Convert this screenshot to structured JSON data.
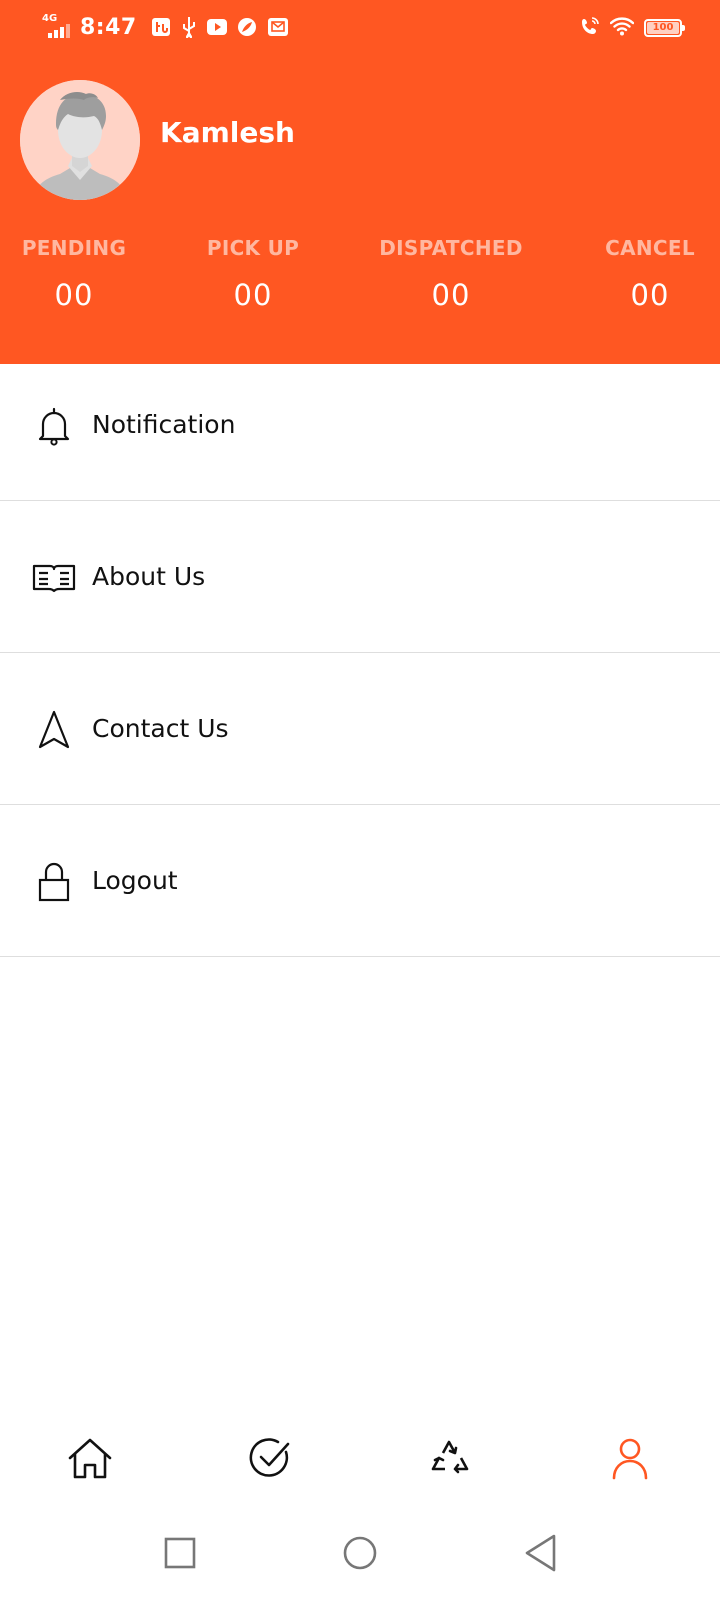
{
  "status_bar": {
    "network": "4G",
    "time": "8:47",
    "battery": "100",
    "icons": [
      "usb-debug-icon",
      "usb-icon",
      "youtube-icon",
      "leaf-app-icon",
      "mail-icon",
      "wifi-calling-icon",
      "wifi-icon",
      "battery-icon"
    ]
  },
  "profile": {
    "name": "Kamlesh",
    "avatar_icon": "default-user-avatar"
  },
  "stats": [
    {
      "label": "PENDING",
      "value": "00"
    },
    {
      "label": "PICK UP",
      "value": "00"
    },
    {
      "label": "DISPATCHED",
      "value": "00"
    },
    {
      "label": "CANCEL",
      "value": "00"
    }
  ],
  "menu": {
    "items": [
      {
        "label": "Notification",
        "icon": "bell-icon"
      },
      {
        "label": "About Us",
        "icon": "book-icon"
      },
      {
        "label": "Contact Us",
        "icon": "navigation-arrow-icon"
      },
      {
        "label": "Logout",
        "icon": "lock-icon"
      }
    ]
  },
  "bottom_nav": {
    "tabs": [
      {
        "icon": "home-icon",
        "active": false
      },
      {
        "icon": "check-circle-icon",
        "active": false
      },
      {
        "icon": "recycle-icon",
        "active": false
      },
      {
        "icon": "user-icon",
        "active": true
      }
    ]
  },
  "colors": {
    "primary": "#ff5722",
    "stat_label": "#ffb7a0",
    "text_dark": "#111111",
    "divider": "#dedede",
    "active_tab": "#ff5722"
  }
}
